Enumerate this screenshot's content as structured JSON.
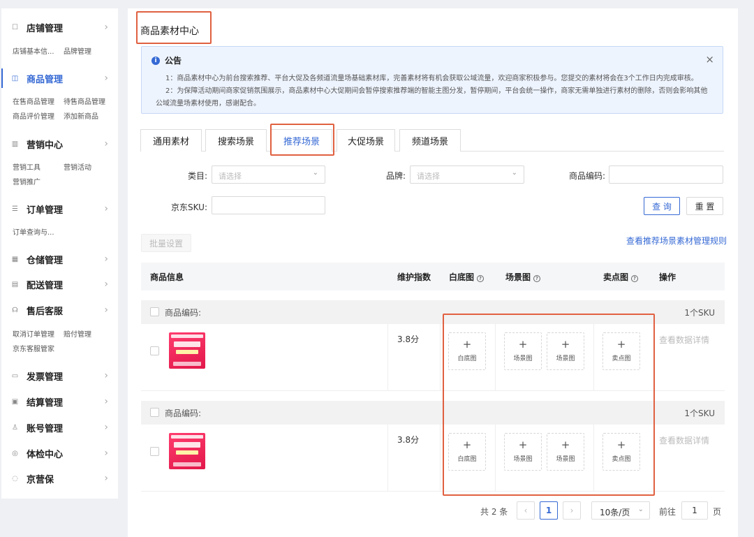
{
  "sidebar": {
    "sections": [
      {
        "label": "店铺管理",
        "subs": [
          "店铺基本信...",
          "品牌管理"
        ]
      },
      {
        "label": "商品管理",
        "subs": [
          "在售商品管理",
          "待售商品管理",
          "商品评价管理",
          "添加新商品"
        ]
      },
      {
        "label": "营销中心",
        "subs": [
          "营销工具",
          "营销活动",
          "营销推广"
        ]
      },
      {
        "label": "订单管理",
        "subs": [
          "订单查询与..."
        ]
      },
      {
        "label": "仓储管理",
        "subs": []
      },
      {
        "label": "配送管理",
        "subs": []
      },
      {
        "label": "售后客服",
        "subs": [
          "取消订单管理",
          "赔付管理",
          "京东客服管家"
        ]
      },
      {
        "label": "发票管理",
        "subs": []
      },
      {
        "label": "结算管理",
        "subs": []
      },
      {
        "label": "账号管理",
        "subs": []
      },
      {
        "label": "体检中心",
        "subs": []
      },
      {
        "label": "京营保",
        "subs": []
      }
    ],
    "active_index": 1
  },
  "page": {
    "title": "商品素材中心"
  },
  "notice": {
    "title": "公告",
    "lines": [
      "1：商品素材中心为前台搜索推荐、平台大促及各频道流量场基础素材库，完善素材将有机会获取公域流量，欢迎商家积极参与。您提交的素材将会在3个工作日内完成审核。",
      "2：为保障活动期间商家促销氛围展示，商品素材中心大促期间会暂停搜索推荐端的智能主图分发，暂停期间，平台会统一操作，商家无需单独进行素材的删除，否则会影响其他",
      "公域流量场素材使用，感谢配合。"
    ]
  },
  "tabs": [
    "通用素材",
    "搜索场景",
    "推荐场景",
    "大促场景",
    "频道场景"
  ],
  "active_tab": 2,
  "filters": {
    "category_label": "类目:",
    "category_placeholder": "请选择",
    "brand_label": "品牌:",
    "brand_placeholder": "请选择",
    "code_label": "商品编码:",
    "sku_label": "京东SKU:",
    "search_button": "查 询",
    "reset_button": "重 置"
  },
  "batch_button": "批量设置",
  "rules_link": "查看推荐场景素材管理规则",
  "table": {
    "headers": {
      "info": "商品信息",
      "index": "维护指数",
      "white": "白底图",
      "scene": "场景图",
      "selling": "卖点图",
      "action": "操作"
    },
    "groups": [
      {
        "code_label": "商品编码:",
        "sku_count": "1个SKU",
        "score": "3.8分",
        "upload_white": "白底图",
        "upload_scene": "场景图",
        "upload_selling": "卖点图",
        "plus": "+",
        "detail": "查看数据详情"
      },
      {
        "code_label": "商品编码:",
        "sku_count": "1个SKU",
        "score": "3.8分",
        "upload_white": "白底图",
        "upload_scene": "场景图",
        "upload_selling": "卖点图",
        "plus": "+",
        "detail": "查看数据详情"
      }
    ]
  },
  "pagination": {
    "total": "共 2 条",
    "prev": "‹",
    "current": "1",
    "next": "›",
    "page_size": "10条/页",
    "goto_label": "前往",
    "goto_value": "1",
    "page_unit": "页"
  },
  "colors": {
    "accent": "#3569d4",
    "highlight": "#e06040"
  },
  "icons": {
    "question": "?",
    "close": "×",
    "info": "i",
    "chevron": "›",
    "dropdown": "⌄"
  }
}
